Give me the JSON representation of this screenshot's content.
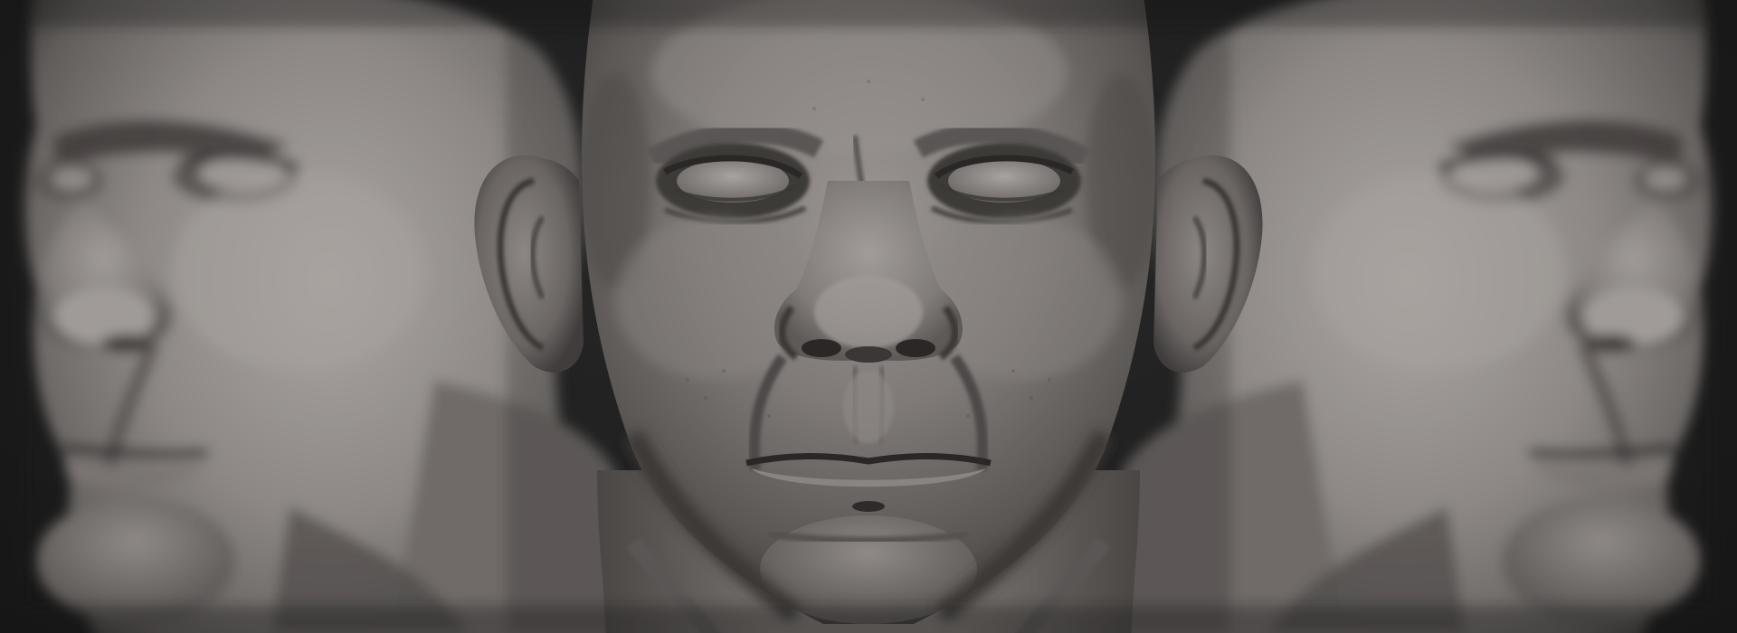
{
  "scene": {
    "description_visible_text": "",
    "colors": {
      "background": "#1c1c1c",
      "clay_light": "#a29d9a",
      "clay_mid": "#7a7572",
      "clay_dark": "#4a4644",
      "clay_shadow": "#2e2b2a"
    }
  }
}
